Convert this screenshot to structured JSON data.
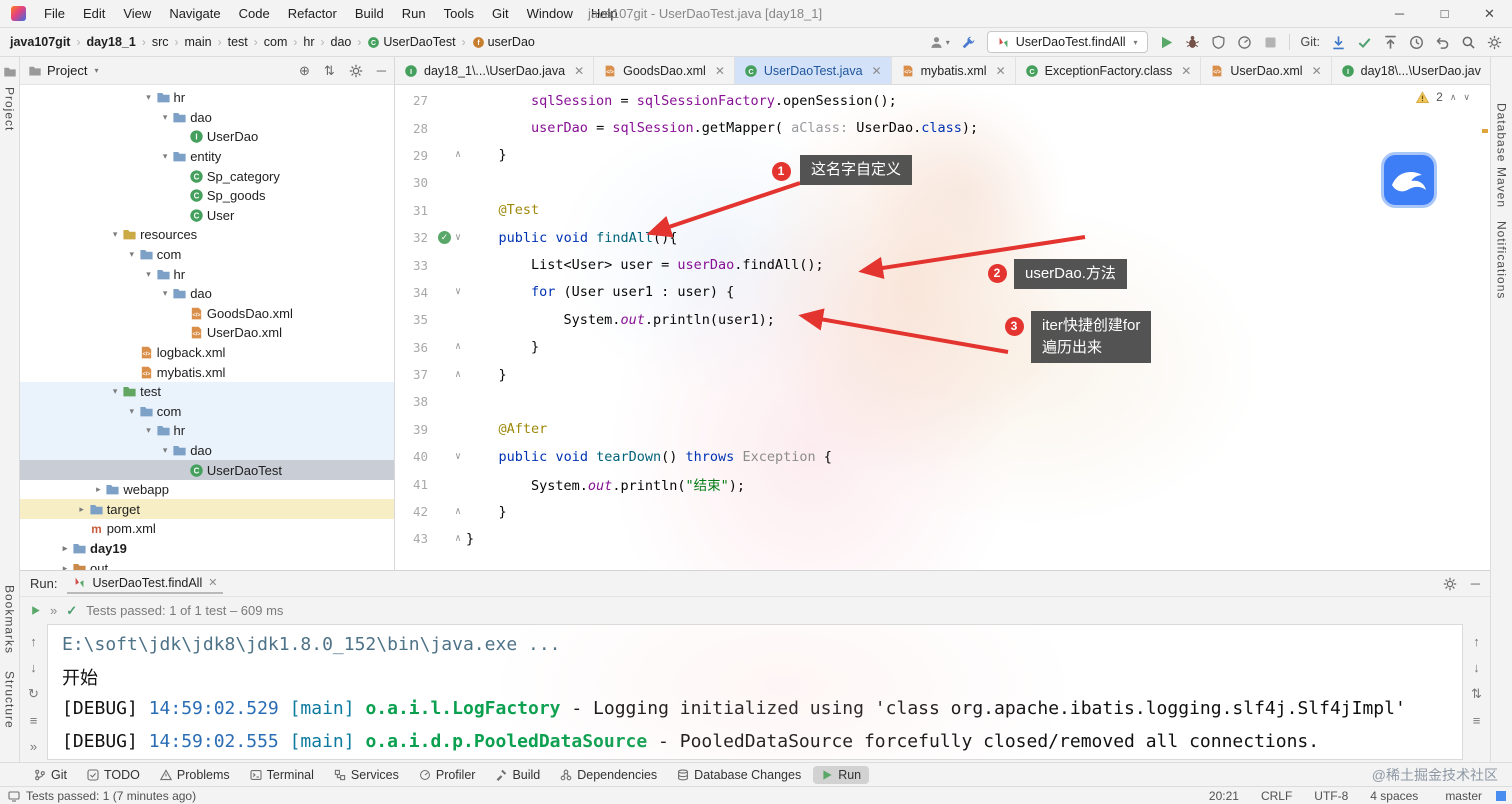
{
  "titlebar": {
    "title": "java107git - UserDaoTest.java [day18_1]",
    "menus": [
      "File",
      "Edit",
      "View",
      "Navigate",
      "Code",
      "Refactor",
      "Build",
      "Run",
      "Tools",
      "Git",
      "Window",
      "Help"
    ]
  },
  "navbar": {
    "breadcrumbs": [
      {
        "label": "java107git",
        "bold": true
      },
      {
        "label": "day18_1",
        "bold": true
      },
      {
        "label": "src"
      },
      {
        "label": "main"
      },
      {
        "label": "test"
      },
      {
        "label": "com"
      },
      {
        "label": "hr"
      },
      {
        "label": "dao"
      },
      {
        "label": "UserDaoTest",
        "icon": "class"
      },
      {
        "label": "userDao",
        "icon": "field"
      }
    ],
    "run_config": "UserDaoTest.findAll",
    "git_label": "Git:"
  },
  "left_stripe": [
    "Project",
    "Bookmarks",
    "Structure"
  ],
  "right_stripe": [
    "Database",
    "Maven",
    "Notifications"
  ],
  "project_panel": {
    "title": "Project",
    "tree": [
      {
        "l": "hr",
        "lv": 5,
        "ic": "folder",
        "ch": "v"
      },
      {
        "l": "dao",
        "lv": 6,
        "ic": "folder",
        "ch": "v"
      },
      {
        "l": "UserDao",
        "lv": 7,
        "ic": "interface"
      },
      {
        "l": "entity",
        "lv": 6,
        "ic": "folder",
        "ch": "v"
      },
      {
        "l": "Sp_category",
        "lv": 7,
        "ic": "class"
      },
      {
        "l": "Sp_goods",
        "lv": 7,
        "ic": "class"
      },
      {
        "l": "User",
        "lv": 7,
        "ic": "class"
      },
      {
        "l": "resources",
        "lv": 3,
        "ic": "folder-res",
        "ch": "v"
      },
      {
        "l": "com",
        "lv": 4,
        "ic": "folder",
        "ch": "v"
      },
      {
        "l": "hr",
        "lv": 5,
        "ic": "folder",
        "ch": "v"
      },
      {
        "l": "dao",
        "lv": 6,
        "ic": "folder",
        "ch": "v"
      },
      {
        "l": "GoodsDao.xml",
        "lv": 7,
        "ic": "xml"
      },
      {
        "l": "UserDao.xml",
        "lv": 7,
        "ic": "xml"
      },
      {
        "l": "logback.xml",
        "lv": 4,
        "ic": "xml"
      },
      {
        "l": "mybatis.xml",
        "lv": 4,
        "ic": "xml"
      },
      {
        "l": "test",
        "lv": 3,
        "ic": "folder-test",
        "ch": "v",
        "hl": "blue"
      },
      {
        "l": "com",
        "lv": 4,
        "ic": "folder",
        "ch": "v",
        "hl": "blue"
      },
      {
        "l": "hr",
        "lv": 5,
        "ic": "folder",
        "ch": "v",
        "hl": "blue"
      },
      {
        "l": "dao",
        "lv": 6,
        "ic": "folder",
        "ch": "v",
        "hl": "blue"
      },
      {
        "l": "UserDaoTest",
        "lv": 7,
        "ic": "class",
        "hl": "sel"
      },
      {
        "l": "webapp",
        "lv": 2,
        "ic": "folder",
        "ch": ">"
      },
      {
        "l": "target",
        "lv": 1,
        "ic": "folder",
        "ch": ">",
        "hl": "yellow"
      },
      {
        "l": "pom.xml",
        "lv": 1,
        "ic": "maven"
      },
      {
        "l": "day19",
        "lv": 0,
        "ic": "folder",
        "ch": ">",
        "bold": true
      },
      {
        "l": "out",
        "lv": 0,
        "ic": "folder-out",
        "ch": ">"
      }
    ]
  },
  "editor": {
    "tabs": [
      {
        "label": "day18_1\\...\\UserDao.java",
        "icon": "interface"
      },
      {
        "label": "GoodsDao.xml",
        "icon": "xml"
      },
      {
        "label": "UserDaoTest.java",
        "icon": "class",
        "selected": true
      },
      {
        "label": "mybatis.xml",
        "icon": "xml"
      },
      {
        "label": "ExceptionFactory.class",
        "icon": "class"
      },
      {
        "label": "UserDao.xml",
        "icon": "xml"
      },
      {
        "label": "day18\\...\\UserDao.jav",
        "icon": "interface"
      }
    ],
    "inspection": {
      "warnings": "2"
    },
    "code": [
      {
        "n": 27,
        "segs": [
          [
            "        ",
            "p"
          ],
          [
            "sqlSession",
            "f"
          ],
          [
            " = ",
            "p"
          ],
          [
            "sqlSessionFactory",
            "f"
          ],
          [
            ".openSession();",
            "p"
          ]
        ]
      },
      {
        "n": 28,
        "segs": [
          [
            "        ",
            "p"
          ],
          [
            "userDao",
            "f"
          ],
          [
            " = ",
            "p"
          ],
          [
            "sqlSession",
            "f"
          ],
          [
            ".getMapper( ",
            "p"
          ],
          [
            "aClass: ",
            "h"
          ],
          [
            "UserDao.",
            "p"
          ],
          [
            "class",
            "k"
          ],
          [
            ");",
            "p"
          ]
        ]
      },
      {
        "n": 29,
        "fold": "end",
        "segs": [
          [
            "    }",
            "p"
          ]
        ]
      },
      {
        "n": 30,
        "segs": []
      },
      {
        "n": 31,
        "segs": [
          [
            "    ",
            "p"
          ],
          [
            "@Test",
            "a"
          ]
        ]
      },
      {
        "n": 32,
        "run": true,
        "fold": "open",
        "segs": [
          [
            "    ",
            "p"
          ],
          [
            "public",
            "k"
          ],
          [
            " ",
            "p"
          ],
          [
            "void",
            "k"
          ],
          [
            " ",
            "p"
          ],
          [
            "findAll",
            "m"
          ],
          [
            "(){",
            "p"
          ]
        ]
      },
      {
        "n": 33,
        "segs": [
          [
            "        List<User> user = ",
            "p"
          ],
          [
            "userDao",
            "f"
          ],
          [
            ".findAll();",
            "p"
          ]
        ]
      },
      {
        "n": 34,
        "fold": "open",
        "segs": [
          [
            "        ",
            "p"
          ],
          [
            "for",
            "k"
          ],
          [
            " (User user1 : user) {",
            "p"
          ]
        ]
      },
      {
        "n": 35,
        "segs": [
          [
            "            System.",
            "p"
          ],
          [
            "out",
            "fi"
          ],
          [
            ".println(user1);",
            "p"
          ]
        ]
      },
      {
        "n": 36,
        "fold": "end",
        "segs": [
          [
            "        }",
            "p"
          ]
        ]
      },
      {
        "n": 37,
        "fold": "end",
        "segs": [
          [
            "    }",
            "p"
          ]
        ]
      },
      {
        "n": 38,
        "segs": []
      },
      {
        "n": 39,
        "segs": [
          [
            "    ",
            "p"
          ],
          [
            "@After",
            "a"
          ]
        ]
      },
      {
        "n": 40,
        "fold": "open",
        "segs": [
          [
            "    ",
            "p"
          ],
          [
            "public",
            "k"
          ],
          [
            " ",
            "p"
          ],
          [
            "void",
            "k"
          ],
          [
            " ",
            "p"
          ],
          [
            "tearDown",
            "m"
          ],
          [
            "() ",
            "p"
          ],
          [
            "throws",
            "k"
          ],
          [
            " ",
            "p"
          ],
          [
            "Exception",
            "g"
          ],
          [
            " {",
            "p"
          ]
        ]
      },
      {
        "n": 41,
        "segs": [
          [
            "        System.",
            "p"
          ],
          [
            "out",
            "fi"
          ],
          [
            ".println(",
            "p"
          ],
          [
            "\"结束\"",
            "s"
          ],
          [
            ");",
            "p"
          ]
        ]
      },
      {
        "n": 42,
        "fold": "end",
        "segs": [
          [
            "    }",
            "p"
          ]
        ]
      },
      {
        "n": 43,
        "fold": "end",
        "segs": [
          [
            "}",
            "p"
          ]
        ]
      }
    ],
    "callouts": [
      {
        "n": "1",
        "lines": [
          "这名字自定义"
        ]
      },
      {
        "n": "2",
        "lines": [
          "userDao.方法"
        ]
      },
      {
        "n": "3",
        "lines": [
          "iter快捷创建for",
          "遍历出来"
        ]
      }
    ]
  },
  "run_panel": {
    "label": "Run:",
    "tab": "UserDaoTest.findAll",
    "status": "Tests passed: 1 of 1 test – 609 ms",
    "console": [
      [
        [
          "E:\\soft\\jdk\\jdk8\\jdk1.8.0_152\\bin\\java.exe ...",
          "cmd"
        ]
      ],
      [
        [
          "开始",
          "pl"
        ]
      ],
      [
        [
          "[DEBUG] ",
          "pl"
        ],
        [
          "14:59:02.529",
          "tm"
        ],
        [
          " [main] ",
          "th"
        ],
        [
          "o.a.i.l.LogFactory",
          "lg"
        ],
        [
          " - Logging initialized using 'class org.apache.ibatis.logging.slf4j.Slf4jImpl'",
          "pl"
        ]
      ],
      [
        [
          "[DEBUG] ",
          "pl"
        ],
        [
          "14:59:02.555",
          "tm"
        ],
        [
          " [main] ",
          "th"
        ],
        [
          "o.a.i.d.p.PooledDataSource",
          "lg"
        ],
        [
          " - PooledDataSource forcefully closed/removed all connections.",
          "pl"
        ]
      ]
    ]
  },
  "bottom_bar": {
    "items": [
      {
        "label": "Git",
        "icon": "git-branch"
      },
      {
        "label": "TODO",
        "icon": "todo"
      },
      {
        "label": "Problems",
        "icon": "problems"
      },
      {
        "label": "Terminal",
        "icon": "terminal"
      },
      {
        "label": "Services",
        "icon": "services"
      },
      {
        "label": "Profiler",
        "icon": "profiler"
      },
      {
        "label": "Build",
        "icon": "build"
      },
      {
        "label": "Dependencies",
        "icon": "dependencies"
      },
      {
        "label": "Database Changes",
        "icon": "database"
      },
      {
        "label": "Run",
        "icon": "run",
        "selected": true
      }
    ],
    "watermark": "@稀土掘金技术社区"
  },
  "statusbar": {
    "left": "Tests passed: 1 (7 minutes ago)",
    "items": [
      "20:21",
      "CRLF",
      "UTF-8",
      "4 spaces",
      "master"
    ]
  },
  "colors": {
    "accent": "#3574F0",
    "arrow_red": "#E3342F",
    "test_green": "#59A869"
  }
}
